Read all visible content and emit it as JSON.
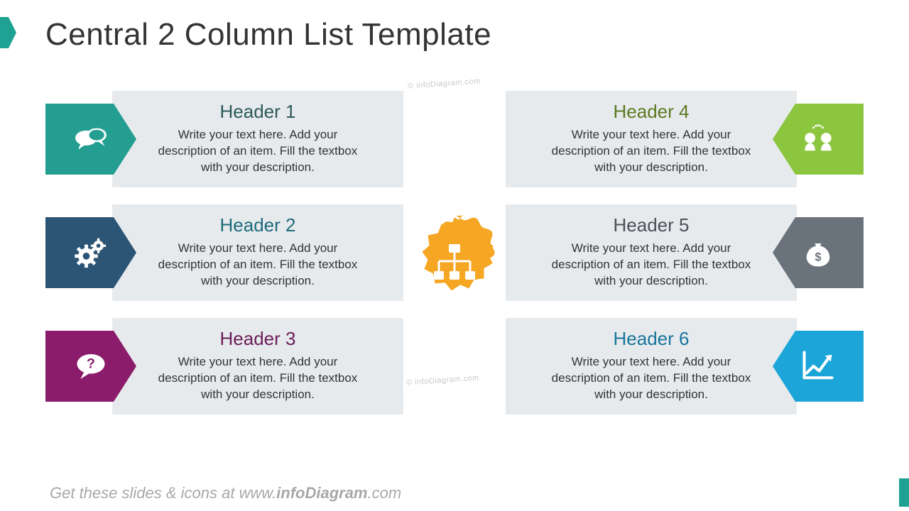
{
  "title": "Central 2 Column List Template",
  "watermark": "© infoDiagram.com",
  "footer_prefix": "Get these slides & icons at www.",
  "footer_bold": "infoDiagram",
  "footer_suffix": ".com",
  "center": {
    "icon": "hierarchy-icon",
    "color": "#f5a623"
  },
  "left": [
    {
      "header": "Header 1",
      "body": "Write your text here. Add your description of an item. Fill the textbox with your description.",
      "color": "#239e91",
      "header_color": "#2b5a57",
      "icon": "chat-bubbles-icon"
    },
    {
      "header": "Header 2",
      "body": "Write your text here. Add your description of an item. Fill the textbox with your description.",
      "color": "#2b5475",
      "header_color": "#1d6b7a",
      "icon": "gears-icon"
    },
    {
      "header": "Header 3",
      "body": "Write your text here. Add your description of an item. Fill the textbox with your description.",
      "color": "#8a1c6b",
      "header_color": "#6a1d58",
      "icon": "question-bubble-icon"
    }
  ],
  "right": [
    {
      "header": "Header 4",
      "body": "Write your text here. Add your description of an item. Fill the textbox with your description.",
      "color": "#8cc63f",
      "header_color": "#5a7a1e",
      "icon": "two-heads-icon"
    },
    {
      "header": "Header 5",
      "body": "Write your text here. Add your description of an item. Fill the textbox with your description.",
      "color": "#6a737b",
      "header_color": "#4a5056",
      "icon": "money-bag-icon"
    },
    {
      "header": "Header 6",
      "body": "Write your text here. Add your description of an item. Fill the textbox with your description.",
      "color": "#1ca5d9",
      "header_color": "#17759c",
      "icon": "growth-chart-icon"
    }
  ]
}
